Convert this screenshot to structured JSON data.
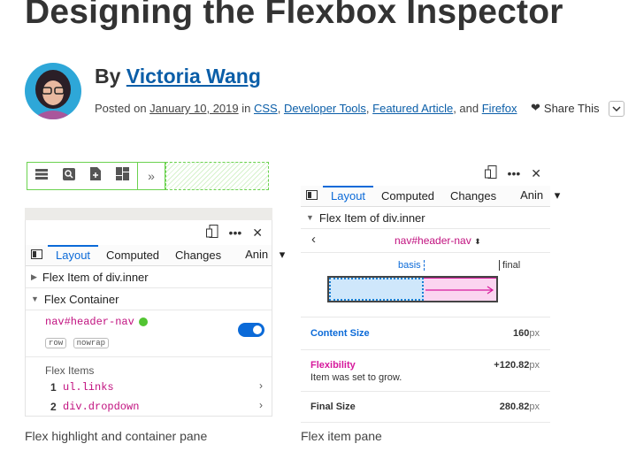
{
  "article": {
    "title": "Designing the Flexbox Inspector",
    "by": "By ",
    "author": "Victoria Wang",
    "posted_on": "Posted on ",
    "date": "January 10, 2019",
    "in": " in ",
    "cat1": "CSS",
    "cat2": "Developer Tools",
    "cat3": "Featured Article",
    "and": ", and ",
    "cat4": "Firefox",
    "share": "Share This"
  },
  "left_pane": {
    "tabs": [
      "Layout",
      "Computed",
      "Changes",
      "Anin"
    ],
    "flex_item_row": "Flex Item of div.inner",
    "flex_container_row": "Flex Container",
    "selector": "nav#header-nav",
    "pills": [
      "row",
      "nowrap"
    ],
    "flex_items_label": "Flex Items",
    "items": [
      {
        "num": "1",
        "name": "ul.links"
      },
      {
        "num": "2",
        "name": "div.dropdown"
      }
    ],
    "caption": "Flex highlight and container pane"
  },
  "right_pane": {
    "tabs": [
      "Layout",
      "Computed",
      "Changes",
      "Anin"
    ],
    "flex_item_row": "Flex Item of div.inner",
    "selector": "nav#header-nav",
    "basis_label": "basis",
    "final_label": "final",
    "content_size_label": "Content Size",
    "content_size_value": "160",
    "flexibility_label": "Flexibility",
    "flexibility_note": "Item was set to grow.",
    "flexibility_value": "+120.82",
    "final_size_label": "Final Size",
    "final_size_value": "280.82",
    "unit": "px",
    "caption": "Flex item pane"
  },
  "colors": {
    "accent": "#0b6ad8",
    "link": "#0b5ea8",
    "highlight": "#6bd24f",
    "magenta": "#d6199c"
  }
}
